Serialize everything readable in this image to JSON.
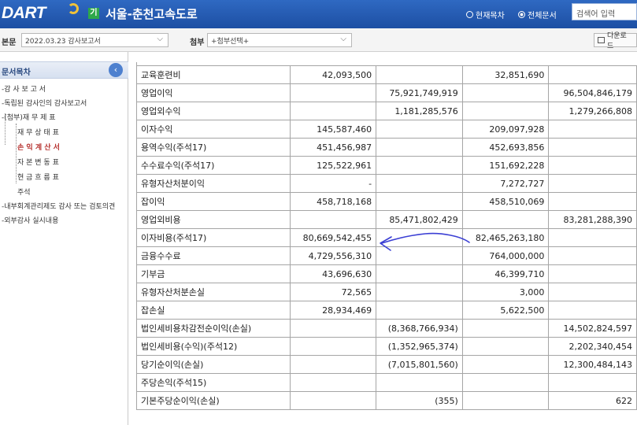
{
  "header": {
    "logo": "DART",
    "company_badge": "기",
    "company_name": "서울-춘천고속도로",
    "radio_current": "현재목차",
    "radio_all": "전체문서",
    "search_placeholder": "검색어 입력"
  },
  "toolbar": {
    "main_label": "본문",
    "main_select": "2022.03.23  감사보고서",
    "attach_label": "첨부",
    "attach_select": "+첨부선택+",
    "download": "다운로드"
  },
  "sidebar": {
    "title": "문서목차",
    "collapse_icon": "chevron-left-icon",
    "items": [
      "-감 사 보 고 서",
      "-독립된 감사인의 감사보고서",
      "-(첨부)재 무 제 표",
      "재 무 상 태 표",
      "손 익 계 산 서",
      "자 본 변 동 표",
      "현 금 흐 름 표",
      "주석",
      "-내부회계관리제도 감사 또는 검토의견",
      "-외부감사 실시내용"
    ],
    "active_index": 4
  },
  "table": {
    "rows": [
      [
        "교육훈련비",
        "42,093,500",
        "",
        "32,851,690",
        ""
      ],
      [
        "영업이익",
        "",
        "75,921,749,919",
        "",
        "96,504,846,179"
      ],
      [
        "영업외수익",
        "",
        "1,181,285,576",
        "",
        "1,279,266,808"
      ],
      [
        "이자수익",
        "145,587,460",
        "",
        "209,097,928",
        ""
      ],
      [
        "용역수익(주석17)",
        "451,456,987",
        "",
        "452,693,856",
        ""
      ],
      [
        "수수료수익(주석17)",
        "125,522,961",
        "",
        "151,692,228",
        ""
      ],
      [
        "유형자산처분이익",
        "-",
        "",
        "7,272,727",
        ""
      ],
      [
        "잡이익",
        "458,718,168",
        "",
        "458,510,069",
        ""
      ],
      [
        "영업외비용",
        "",
        "85,471,802,429",
        "",
        "83,281,288,390"
      ],
      [
        "이자비용(주석17)",
        "80,669,542,455",
        "",
        "82,465,263,180",
        ""
      ],
      [
        "금융수수료",
        "4,729,556,310",
        "",
        "764,000,000",
        ""
      ],
      [
        "기부금",
        "43,696,630",
        "",
        "46,399,710",
        ""
      ],
      [
        "유형자산처분손실",
        "72,565",
        "",
        "3,000",
        ""
      ],
      [
        "잡손실",
        "28,934,469",
        "",
        "5,622,500",
        ""
      ],
      [
        "법인세비용차감전순이익(손실)",
        "",
        "(8,368,766,934)",
        "",
        "14,502,824,597"
      ],
      [
        "법인세비용(수익)(주석12)",
        "",
        "(1,352,965,374)",
        "",
        "2,202,340,454"
      ],
      [
        "당기순이익(손실)",
        "",
        "(7,015,801,560)",
        "",
        "12,300,484,143"
      ],
      [
        "주당손익(주석15)",
        "",
        "",
        "",
        ""
      ],
      [
        "기본주당순이익(손실)",
        "",
        "(355)",
        "",
        "622"
      ]
    ],
    "indented": [
      0,
      3,
      4,
      5,
      6,
      7,
      9,
      10,
      11,
      12,
      13,
      18
    ]
  },
  "annotation": {
    "color": "#3b3fd4"
  }
}
